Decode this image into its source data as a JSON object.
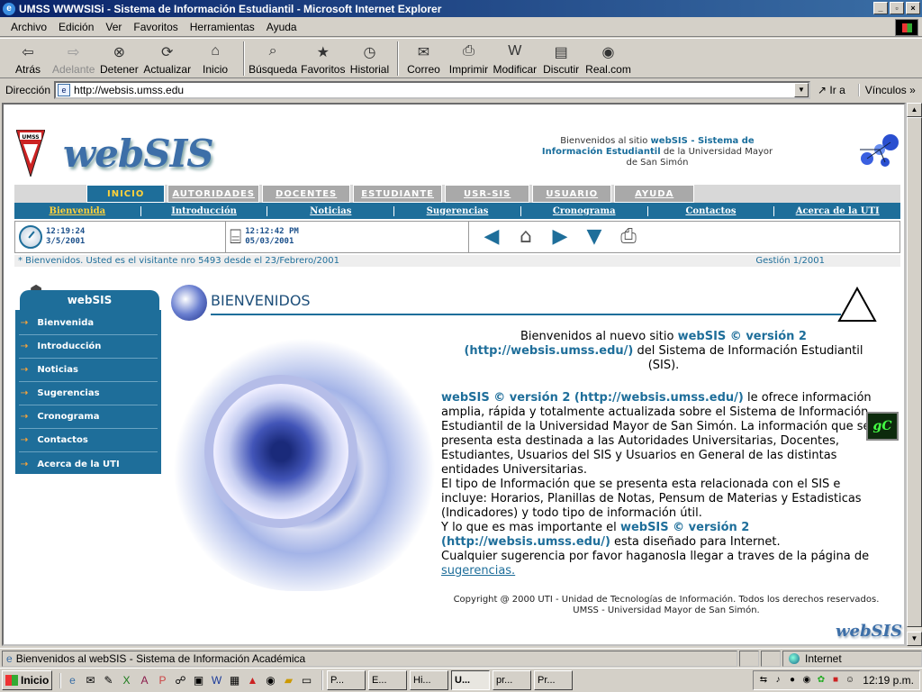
{
  "window": {
    "title": "UMSS WWWSISi - Sistema de Información Estudiantil - Microsoft Internet Explorer"
  },
  "menu": [
    "Archivo",
    "Edición",
    "Ver",
    "Favoritos",
    "Herramientas",
    "Ayuda"
  ],
  "toolbar": [
    {
      "label": "Atrás",
      "icon": "back-arrow-icon"
    },
    {
      "label": "Adelante",
      "icon": "forward-arrow-icon"
    },
    {
      "label": "Detener",
      "icon": "stop-icon"
    },
    {
      "label": "Actualizar",
      "icon": "refresh-icon"
    },
    {
      "label": "Inicio",
      "icon": "home-icon"
    },
    {
      "label": "Búsqueda",
      "icon": "search-icon"
    },
    {
      "label": "Favoritos",
      "icon": "favorites-icon"
    },
    {
      "label": "Historial",
      "icon": "history-icon"
    },
    {
      "label": "Correo",
      "icon": "mail-icon"
    },
    {
      "label": "Imprimir",
      "icon": "print-icon"
    },
    {
      "label": "Modificar",
      "icon": "edit-icon"
    },
    {
      "label": "Discutir",
      "icon": "discuss-icon"
    },
    {
      "label": "Real.com",
      "icon": "realcom-icon"
    }
  ],
  "address": {
    "label": "Dirección",
    "url": "http://websis.umss.edu",
    "go": "Ir a",
    "links": "Vínculos"
  },
  "header": {
    "welcome_pre": "Bienvenidos al sitio ",
    "welcome_hl": "webSIS - Sistema de Información Estudiantil",
    "welcome_post": " de la Universidad Mayor de San Simón",
    "logo_text": "webSIS",
    "umss_label": "UMSS"
  },
  "tabs": [
    "INICIO",
    "AUTORIDADES",
    "DOCENTES",
    "ESTUDIANTE",
    "USR-SIS",
    "USUARIO",
    "AYUDA"
  ],
  "subnav": [
    "Bienvenida",
    "Introducción",
    "Noticias",
    "Sugerencias",
    "Cronograma",
    "Contactos",
    "Acerca de la UTI"
  ],
  "info": {
    "time1": "12:19:24",
    "date1": "3/5/2001",
    "time2": "12:12:42 PM",
    "date2": "05/03/2001"
  },
  "visitor": {
    "text": "* Bienvenidos. Usted es el visitante nro 5493 desde el 23/Febrero/2001",
    "gestion": "Gestión 1/2001"
  },
  "sidebar": {
    "title": "webSIS",
    "items": [
      "Bienvenida",
      "Introducción",
      "Noticias",
      "Sugerencias",
      "Cronograma",
      "Contactos",
      "Acerca de la UTI"
    ]
  },
  "section": {
    "title": "BIENVENIDOS"
  },
  "intro": {
    "pre": "Bienvenidos al nuevo sitio ",
    "hl": "webSIS © versión 2 (http://websis.umss.edu/)",
    "post": " del Sistema de Información Estudiantil (SIS)."
  },
  "body": {
    "p1_hl": "webSIS © versión 2 (http://websis.umss.edu/)",
    "p1": " le ofrece información amplia, rápida y totalmente actualizada sobre el Sistema de Información Estudiantil de la Universidad Mayor de San Simón. La información que se presenta esta destinada a las Autoridades Universitarias, Docentes, Estudiantes, Usuarios del SIS y Usuarios en General de las distintas entidades Universitarias.",
    "p2": "El tipo de Información que se presenta esta relacionada con el SIS e incluye: Horarios, Planillas de Notas, Pensum de Materias y Estadisticas (Indicadores) y todo tipo de información útil.",
    "p3_pre": "Y lo que es mas importante el ",
    "p3_hl": "webSIS © versión 2 (http://websis.umss.edu/)",
    "p3_post": " esta diseñado para Internet.",
    "p4": "Cualquier sugerencia por favor haganosla llegar a traves de la página de ",
    "p4_link": "sugerencias."
  },
  "copyright": {
    "line1": "Copyright @ 2000 UTI - Unidad de Tecnologías de Información. Todos los derechos reservados.",
    "line2": "UMSS - Universidad Mayor de San Simón."
  },
  "badge": "gC",
  "footer_logo": "webSIS",
  "status": {
    "message": "Bienvenidos al webSIS - Sistema de Información Académica",
    "zone": "Internet"
  },
  "taskbar": {
    "start": "Inicio",
    "tasks": [
      "P...",
      "E...",
      "Hi...",
      "U...",
      "pr...",
      "Pr..."
    ],
    "clock": "12:19 p.m."
  }
}
